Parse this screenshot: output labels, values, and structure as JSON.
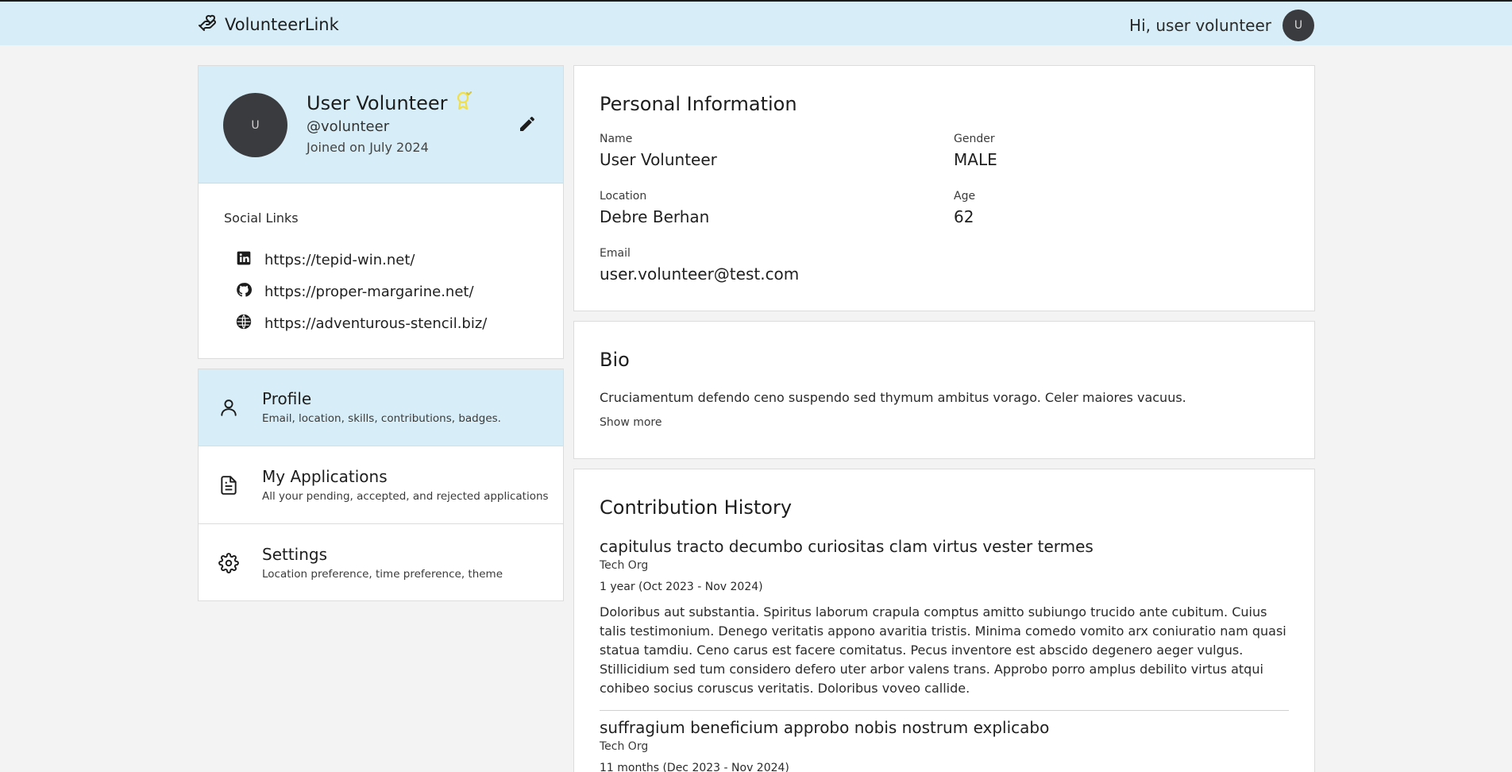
{
  "header": {
    "brand": "VolunteerLink",
    "greeting": "Hi, user volunteer",
    "avatar_initial": "U"
  },
  "profile": {
    "avatar_initial": "U",
    "name": "User Volunteer",
    "handle": "@volunteer",
    "joined": "Joined on July 2024",
    "badge_color": "#f1e04a"
  },
  "social": {
    "title": "Social Links",
    "links": [
      {
        "icon": "linkedin-icon",
        "url": "https://tepid-win.net/"
      },
      {
        "icon": "github-icon",
        "url": "https://proper-margarine.net/"
      },
      {
        "icon": "globe-icon",
        "url": "https://adventurous-stencil.biz/"
      }
    ]
  },
  "menu": {
    "items": [
      {
        "icon": "person-icon",
        "title": "Profile",
        "subtitle": "Email, location, skills, contributions, badges.",
        "active": true
      },
      {
        "icon": "document-icon",
        "title": "My Applications",
        "subtitle": "All your pending, accepted, and rejected applications",
        "active": false
      },
      {
        "icon": "gear-icon",
        "title": "Settings",
        "subtitle": "Location preference, time preference, theme",
        "active": false
      }
    ]
  },
  "personal_info": {
    "title": "Personal Information",
    "fields": [
      {
        "label": "Name",
        "value": "User Volunteer"
      },
      {
        "label": "Gender",
        "value": "MALE"
      },
      {
        "label": "Location",
        "value": "Debre Berhan"
      },
      {
        "label": "Age",
        "value": "62"
      },
      {
        "label": "Email",
        "value": "user.volunteer@test.com"
      }
    ]
  },
  "bio": {
    "title": "Bio",
    "text": "Cruciamentum defendo ceno suspendo sed thymum ambitus vorago. Celer maiores vacuus.",
    "show_more": "Show more"
  },
  "contribution_history": {
    "title": "Contribution History",
    "items": [
      {
        "title": "capitulus tracto decumbo curiositas clam virtus vester termes",
        "org": "Tech Org",
        "duration": "1 year (Oct 2023 - Nov 2024)",
        "description": "Doloribus aut substantia. Spiritus laborum crapula comptus amitto subiungo trucido ante cubitum. Cuius talis testimonium. Denego veritatis appono avaritia tristis. Minima comedo vomito arx coniuratio nam quasi statua tamdiu. Ceno carus est facere comitatus. Pecus inventore est abscido degenero aeger vulgus. Stillicidium sed tum considero defero uter arbor valens trans. Approbo porro amplus debilito virtus atqui cohibeo socius coruscus veritatis. Doloribus voveo callide."
      },
      {
        "title": "suffragium beneficium approbo nobis nostrum explicabo",
        "org": "Tech Org",
        "duration": "11 months (Dec 2023 - Nov 2024)"
      }
    ]
  }
}
